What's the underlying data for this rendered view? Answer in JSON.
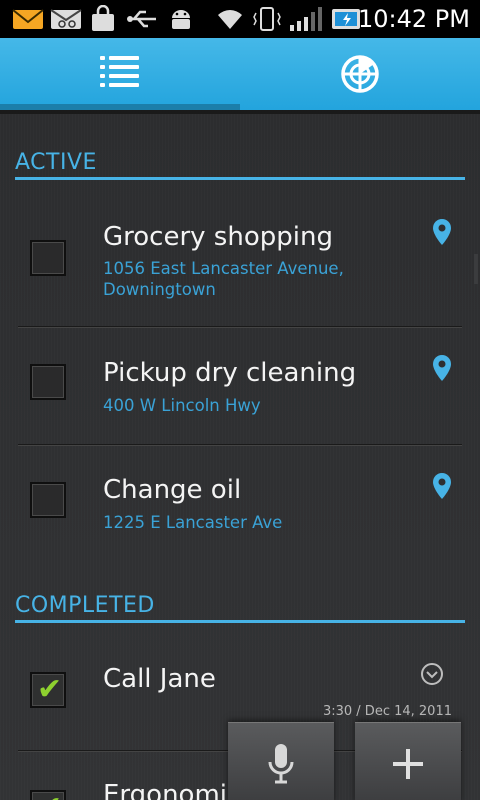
{
  "status_bar": {
    "time": "10:42 PM",
    "icons": [
      "mail-icon",
      "voicemail-icon",
      "bag-icon",
      "usb-icon",
      "android-icon",
      "wifi-icon",
      "vibrate-icon",
      "signal-icon",
      "battery-icon"
    ]
  },
  "tabs": [
    {
      "name": "list-tab",
      "icon": "list-icon",
      "active": true
    },
    {
      "name": "radar-tab",
      "icon": "radar-icon",
      "active": false
    }
  ],
  "sections": {
    "active_label": "ACTIVE",
    "completed_label": "COMPLETED"
  },
  "active_items": [
    {
      "title": "Grocery shopping",
      "subtitle_line1": "1056 East Lancaster Avenue,",
      "subtitle_line2": "Downingtown",
      "icon": "location-pin-icon"
    },
    {
      "title": "Pickup dry cleaning",
      "subtitle_line1": "400 W Lincoln Hwy",
      "icon": "location-pin-icon"
    },
    {
      "title": "Change oil",
      "subtitle_line1": "1225 E Lancaster Ave",
      "icon": "location-pin-icon"
    }
  ],
  "completed_items": [
    {
      "title": "Call Jane",
      "meta": "3:30 / Dec 14, 2011",
      "icon": "clock-icon",
      "checked": true
    },
    {
      "title": "Ergonomic",
      "checked": true
    }
  ],
  "actions": {
    "voice": "microphone-icon",
    "add": "plus-icon"
  },
  "colors": {
    "accent": "#47b3e6",
    "header_blue": "#29a7df",
    "check_green": "#8ed12f",
    "background": "#2e2f31"
  }
}
